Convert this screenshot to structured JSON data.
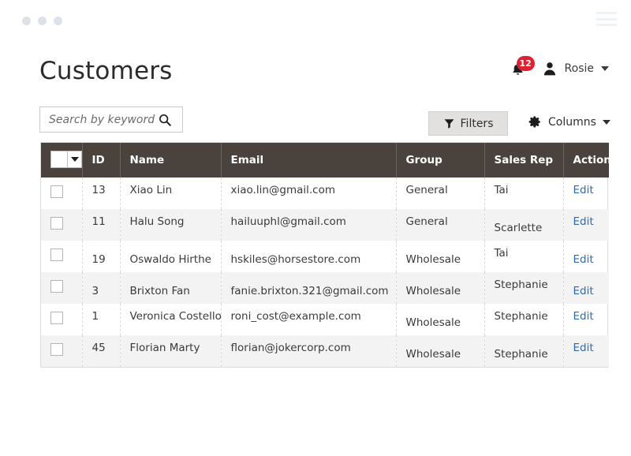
{
  "chrome": {
    "dots": [
      "dot-1",
      "dot-2",
      "dot-3"
    ],
    "menu_icon": "hamburger-icon"
  },
  "header": {
    "title": "Customers",
    "notifications": {
      "icon": "bell-icon",
      "count": "12",
      "badge_color": "#e0202e"
    },
    "user": {
      "icon": "user-avatar-icon",
      "name": "Rosie",
      "caret": "chevron-down-icon"
    }
  },
  "toolbar": {
    "search": {
      "placeholder": "Search by keyword",
      "value": "",
      "icon": "search-icon"
    },
    "filters": {
      "label": "Filters",
      "icon": "funnel-icon"
    },
    "columns": {
      "label": "Columns",
      "icon": "gear-icon",
      "caret": "chevron-down-icon"
    }
  },
  "table": {
    "select_all": {
      "icon": "select-all-dropdown",
      "checked": false
    },
    "columns": [
      "",
      "ID",
      "Name",
      "Email",
      "Group",
      "Sales Rep",
      "Action"
    ],
    "header_bg": "#4a423c",
    "link_color": "#2b6cb8",
    "rows": [
      {
        "id": "13",
        "name": "Xiao Lin",
        "email": "xiao.lin@gmail.com",
        "group": "General",
        "rep": "Tai",
        "action": "Edit"
      },
      {
        "id": "11",
        "name": "Halu Song",
        "email": "hailuuphl@gmail.com",
        "group": "General",
        "rep": "Scarlette",
        "action": "Edit"
      },
      {
        "id": "19",
        "name": "Oswaldo Hirthe",
        "email": "hskiles@horsestore.com",
        "group": "Wholesale",
        "rep": "Tai",
        "action": "Edit"
      },
      {
        "id": "3",
        "name": "Brixton Fan",
        "email": "fanie.brixton.321@gmail.com",
        "group": "Wholesale",
        "rep": "Stephanie",
        "action": "Edit"
      },
      {
        "id": "1",
        "name": "Veronica Costello",
        "email": "roni_cost@example.com",
        "group": "Wholesale",
        "rep": "Stephanie",
        "action": "Edit"
      },
      {
        "id": "45",
        "name": "Florian Marty",
        "email": "florian@jokercorp.com",
        "group": "Wholesale",
        "rep": "Stephanie",
        "action": "Edit"
      }
    ]
  }
}
